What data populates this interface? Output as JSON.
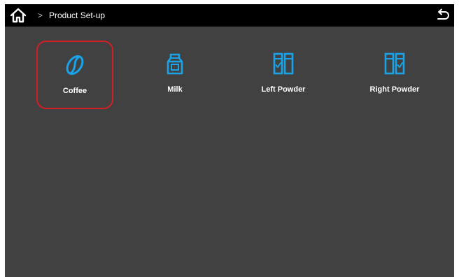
{
  "header": {
    "breadcrumb_separator": ">",
    "title": "Product Set-up",
    "home_icon": "home-icon",
    "back_icon": "back-arrow-icon"
  },
  "colors": {
    "accent": "#1aa3e8",
    "selection": "#d21f26",
    "background": "#414141",
    "topbar": "#000000"
  },
  "products": [
    {
      "label": "Coffee",
      "icon": "coffee-bean-icon",
      "selected": true
    },
    {
      "label": "Milk",
      "icon": "milk-carton-icon",
      "selected": false
    },
    {
      "label": "Left Powder",
      "icon": "powder-canister-left-icon",
      "selected": false
    },
    {
      "label": "Right Powder",
      "icon": "powder-canister-right-icon",
      "selected": false
    }
  ]
}
